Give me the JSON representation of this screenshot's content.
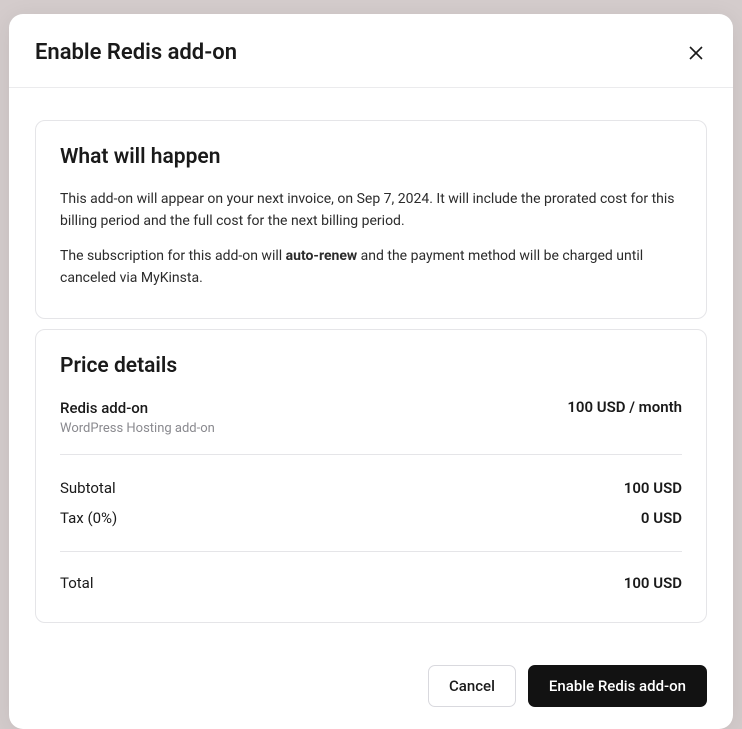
{
  "modal": {
    "title": "Enable Redis add-on"
  },
  "whatWillHappen": {
    "heading": "What will happen",
    "desc1_a": "This add-on will appear on your next invoice, on ",
    "desc1_date": "Sep 7, 2024",
    "desc1_b": ". It will include the prorated cost for this billing period and the full cost for the next billing period.",
    "desc2_a": "The subscription for this add-on will ",
    "desc2_strong": "auto-renew",
    "desc2_b": " and the payment method will be charged until canceled via MyKinsta."
  },
  "priceDetails": {
    "heading": "Price details",
    "item": {
      "name": "Redis add-on",
      "sub": "WordPress Hosting add-on",
      "price": "100 USD / month"
    },
    "subtotal": {
      "label": "Subtotal",
      "value": "100 USD"
    },
    "tax": {
      "label": "Tax (0%)",
      "value": "0 USD"
    },
    "total": {
      "label": "Total",
      "value": "100 USD"
    }
  },
  "footer": {
    "cancel": "Cancel",
    "confirm": "Enable Redis add-on"
  }
}
